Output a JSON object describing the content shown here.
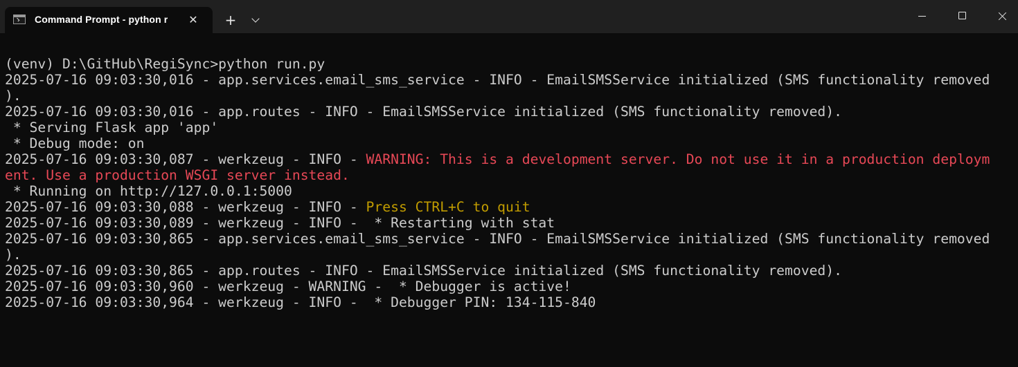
{
  "window": {
    "tab_title": "Command Prompt - python r",
    "icons": {
      "tab": "terminal-icon",
      "tab_close": "close-icon",
      "new_tab": "plus-icon",
      "dropdown": "chevron-down-icon",
      "minimize": "minimize-icon",
      "maximize": "maximize-icon",
      "close": "close-icon"
    }
  },
  "colors": {
    "background": "#0c0c0c",
    "titlebar": "#202020",
    "text": "#cccccc",
    "warning_red": "#e74856",
    "highlight_yellow": "#c19c00"
  },
  "terminal": {
    "lines": [
      [
        {
          "text": "(venv) D:\\GitHub\\RegiSync>python run.py"
        }
      ],
      [
        {
          "text": "2025-07-16 09:03:30,016 - app.services.email_sms_service - INFO - EmailSMSService initialized (SMS functionality removed"
        }
      ],
      [
        {
          "text": ")."
        }
      ],
      [
        {
          "text": "2025-07-16 09:03:30,016 - app.routes - INFO - EmailSMSService initialized (SMS functionality removed)."
        }
      ],
      [
        {
          "text": " * Serving Flask app 'app'"
        }
      ],
      [
        {
          "text": " * Debug mode: on"
        }
      ],
      [
        {
          "text": "2025-07-16 09:03:30,087 - werkzeug - INFO - "
        },
        {
          "text": "WARNING: This is a development server. Do not use it in a production deploym",
          "color": "red"
        }
      ],
      [
        {
          "text": "ent. Use a production WSGI server instead.",
          "color": "red"
        }
      ],
      [
        {
          "text": " * Running on http://127.0.0.1:5000"
        }
      ],
      [
        {
          "text": "2025-07-16 09:03:30,088 - werkzeug - INFO - "
        },
        {
          "text": "Press CTRL+C to quit",
          "color": "yellow"
        }
      ],
      [
        {
          "text": "2025-07-16 09:03:30,089 - werkzeug - INFO -  * Restarting with stat"
        }
      ],
      [
        {
          "text": "2025-07-16 09:03:30,865 - app.services.email_sms_service - INFO - EmailSMSService initialized (SMS functionality removed"
        }
      ],
      [
        {
          "text": ")."
        }
      ],
      [
        {
          "text": "2025-07-16 09:03:30,865 - app.routes - INFO - EmailSMSService initialized (SMS functionality removed)."
        }
      ],
      [
        {
          "text": "2025-07-16 09:03:30,960 - werkzeug - WARNING -  * Debugger is active!"
        }
      ],
      [
        {
          "text": "2025-07-16 09:03:30,964 - werkzeug - INFO -  * Debugger PIN: 134-115-840"
        }
      ]
    ]
  }
}
